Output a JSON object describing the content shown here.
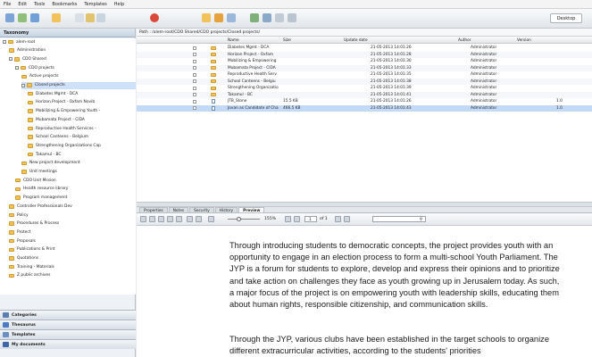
{
  "menu": {
    "items": [
      "File",
      "Edit",
      "Tools",
      "Bookmarks",
      "Templates",
      "Help"
    ]
  },
  "toolbar": {
    "desktop_label": "Desktop"
  },
  "sidebar": {
    "title": "Taxonomy",
    "tree": [
      {
        "label": "alem-root",
        "indent": 0,
        "expand": "-"
      },
      {
        "label": "Administration",
        "indent": 1,
        "expand": ""
      },
      {
        "label": "CDO Shared",
        "indent": 1,
        "expand": "-"
      },
      {
        "label": "CDO projects",
        "indent": 2,
        "expand": "-"
      },
      {
        "label": "Active projects",
        "indent": 3,
        "expand": ""
      },
      {
        "label": "Closed projects",
        "indent": 3,
        "expand": "-",
        "selected": true
      },
      {
        "label": "Diabetes Mgmt - DCA",
        "indent": 4,
        "expand": ""
      },
      {
        "label": "Horizon Project - Oxfam Novib",
        "indent": 4,
        "expand": ""
      },
      {
        "label": "Mobilizing & Empowering Youth -",
        "indent": 4,
        "expand": ""
      },
      {
        "label": "Mubamata Project - CIDA",
        "indent": 4,
        "expand": ""
      },
      {
        "label": "Reproductive Health Services -",
        "indent": 4,
        "expand": ""
      },
      {
        "label": "School Canteens - Belgium",
        "indent": 4,
        "expand": ""
      },
      {
        "label": "Strengthening Organizations Cap",
        "indent": 4,
        "expand": ""
      },
      {
        "label": "Takamul - BC",
        "indent": 4,
        "expand": ""
      },
      {
        "label": "New project development",
        "indent": 3,
        "expand": ""
      },
      {
        "label": "Unit meetings",
        "indent": 3,
        "expand": ""
      },
      {
        "label": "CDO Unit Mssion",
        "indent": 2,
        "expand": ""
      },
      {
        "label": "Health resource library",
        "indent": 2,
        "expand": ""
      },
      {
        "label": "Program management",
        "indent": 2,
        "expand": ""
      },
      {
        "label": "Controller Professionals Dev",
        "indent": 1,
        "expand": ""
      },
      {
        "label": "Policy",
        "indent": 1,
        "expand": ""
      },
      {
        "label": "Procedures & Process",
        "indent": 1,
        "expand": ""
      },
      {
        "label": "Protect",
        "indent": 1,
        "expand": ""
      },
      {
        "label": "Proposals",
        "indent": 1,
        "expand": ""
      },
      {
        "label": "Publications & Print",
        "indent": 1,
        "expand": ""
      },
      {
        "label": "Quotations",
        "indent": 1,
        "expand": ""
      },
      {
        "label": "Training - Materials",
        "indent": 1,
        "expand": ""
      },
      {
        "label": "Z public archives",
        "indent": 1,
        "expand": ""
      }
    ],
    "footer": [
      {
        "label": "Categories",
        "color": "#5b7fb0"
      },
      {
        "label": "Thesaurus",
        "color": "#4c7ac3"
      },
      {
        "label": "Templates",
        "color": "#6b8fbf"
      },
      {
        "label": "My documents",
        "color": "#3e67a8"
      }
    ]
  },
  "path": {
    "text": "Path : /alem-root/CDO Shared/CDO projects/Closed projects/"
  },
  "grid": {
    "headers": {
      "name": "Name",
      "size": "Size",
      "updated": "Update date",
      "author": "Author",
      "version": "Version"
    },
    "rows": [
      {
        "type": "folder",
        "name": "Diabetes Mgmt - DCA",
        "size": "",
        "date": "21-05-2013 14:01:26",
        "author": "Administrator",
        "version": ""
      },
      {
        "type": "folder",
        "name": "Horizon Project - Oxfam",
        "size": "",
        "date": "21-05-2013 14:01:28",
        "author": "Administrator",
        "version": ""
      },
      {
        "type": "folder",
        "name": "Mobilizing & Empowering",
        "size": "",
        "date": "21-05-2013 14:01:30",
        "author": "Administrator",
        "version": ""
      },
      {
        "type": "folder",
        "name": "Mubamata Project - CIDA",
        "size": "",
        "date": "21-05-2013 14:01:33",
        "author": "Administrator",
        "version": ""
      },
      {
        "type": "folder",
        "name": "Reproductive Health Serv",
        "size": "",
        "date": "21-05-2013 14:01:35",
        "author": "Administrator",
        "version": ""
      },
      {
        "type": "folder",
        "name": "School Canteens - Belgiu",
        "size": "",
        "date": "21-05-2013 14:01:38",
        "author": "Administrator",
        "version": ""
      },
      {
        "type": "folder",
        "name": "Strengthening Organizatio",
        "size": "",
        "date": "21-05-2013 14:01:39",
        "author": "Administrator",
        "version": ""
      },
      {
        "type": "folder",
        "name": "Takamul - BC",
        "size": "",
        "date": "21-05-2013 14:01:41",
        "author": "Administrator",
        "version": ""
      },
      {
        "type": "file",
        "name": "JTB_Stone",
        "size": "15.5 KB",
        "date": "21-05-2013 14:01:26",
        "author": "Administrator",
        "version": "1.0"
      },
      {
        "type": "file",
        "name": "Jovan as Candidate of Cha",
        "size": "466.5 KB",
        "date": "21-05-2013 14:01:43",
        "author": "Administrator",
        "version": "1.0",
        "selected": true
      }
    ]
  },
  "tabs": {
    "items": [
      "Properties",
      "Notes",
      "Security",
      "History",
      "Preview"
    ],
    "active": 4
  },
  "preview": {
    "zoom": "155%",
    "page": "1",
    "pages": "of 1",
    "search_placeholder": ""
  },
  "document": {
    "para1": "Through introducing students to democratic concepts, the project provides youth with an opportunity to engage in an election process to form a multi-school Youth Parliament. The JYP is a forum for students to explore, develop and express their opinions and to prioritize and take action on challenges they face as youth growing up in Jerusalem today. As such, a major focus of the project is on empowering youth with leadership skills, educating them about human rights, responsible citizenship, and communication skills.",
    "para2": "Through the JYP, various clubs have been established in the target schools to organize different extracurricular activities, according to the students' priorities"
  }
}
